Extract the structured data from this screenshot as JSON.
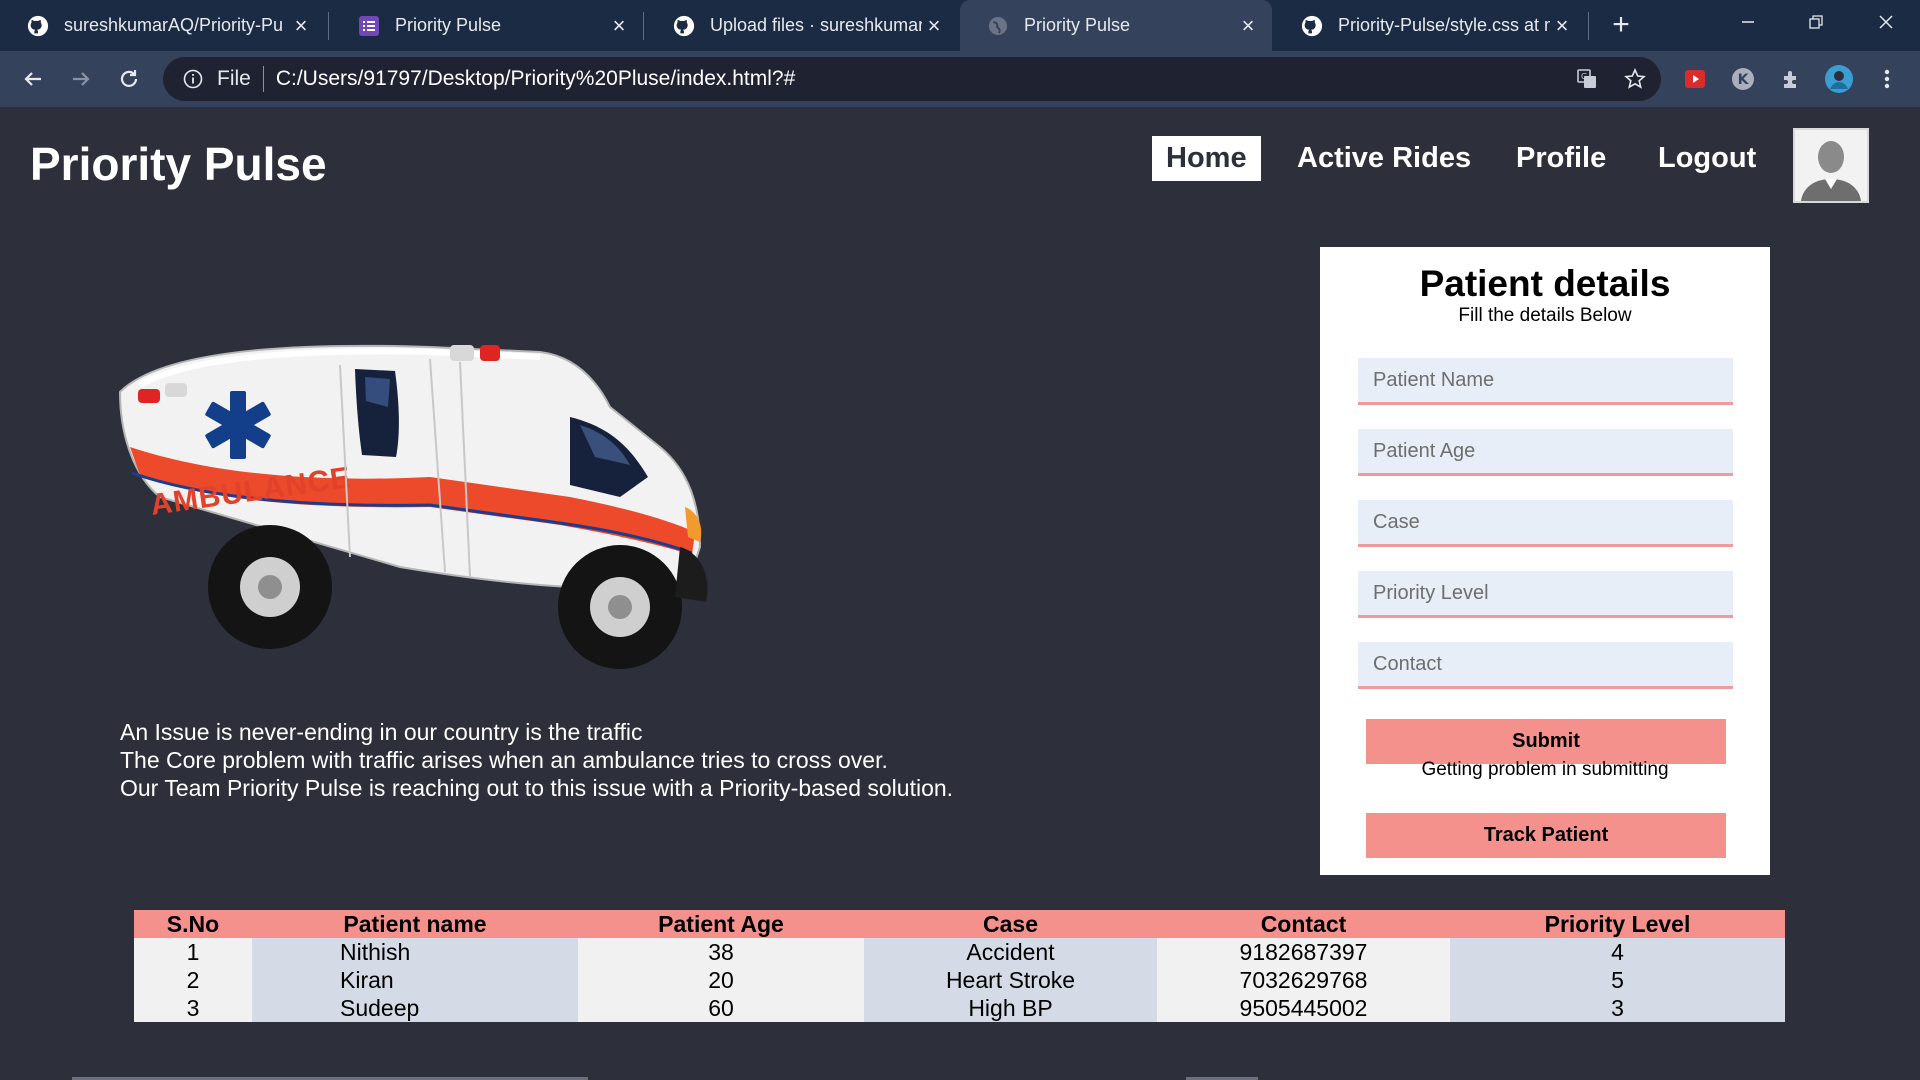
{
  "browser": {
    "tabs": [
      {
        "title": "sureshkumarAQ/Priority-Pu",
        "icon": "github-icon"
      },
      {
        "title": "Priority Pulse",
        "icon": "form-icon"
      },
      {
        "title": "Upload files · sureshkumarA",
        "icon": "github-icon"
      },
      {
        "title": "Priority Pulse",
        "icon": "globe-icon",
        "active": true
      },
      {
        "title": "Priority-Pulse/style.css at m",
        "icon": "github-icon"
      }
    ],
    "address": {
      "scheme": "File",
      "url": "C:/Users/91797/Desktop/Priority%20Pluse/index.html?#"
    },
    "extension_avatar_letter": "K"
  },
  "site": {
    "brand": "Priority Pulse",
    "nav": [
      "Home",
      "Active Rides",
      "Profile",
      "Logout"
    ],
    "active_nav": "Home"
  },
  "hero": {
    "image_label": "AMBULANCE",
    "intro_lines": [
      "An Issue is never-ending in our country is the traffic",
      "The Core problem with traffic arises when an ambulance tries to cross over.",
      "Our Team Priority Pulse is reaching out to this issue with a Priority-based solution."
    ]
  },
  "form": {
    "title": "Patient details",
    "subtitle": "Fill the details Below",
    "placeholders": [
      "Patient Name",
      "Patient Age",
      "Case",
      "Priority Level",
      "Contact"
    ],
    "submit_label": "Submit",
    "note": "Getting problem in submitting",
    "track_label": "Track Patient"
  },
  "table": {
    "headers": [
      "S.No",
      "Patient name",
      "Patient Age",
      "Case",
      "Contact",
      "Priority Level"
    ],
    "rows": [
      [
        "1",
        "Nithish",
        "38",
        "Accident",
        "9182687397",
        "4"
      ],
      [
        "2",
        "Kiran",
        "20",
        "Heart Stroke",
        "7032629768",
        "5"
      ],
      [
        "3",
        "Sudeep",
        "60",
        "High BP",
        "9505445002",
        "3"
      ]
    ]
  },
  "colors": {
    "page_bg": "#2d2f3b",
    "accent_pink": "#f5918d",
    "field_bg": "#e8eef7",
    "tabbar_bg": "#1c2b44",
    "toolbar_bg": "#35425c"
  }
}
